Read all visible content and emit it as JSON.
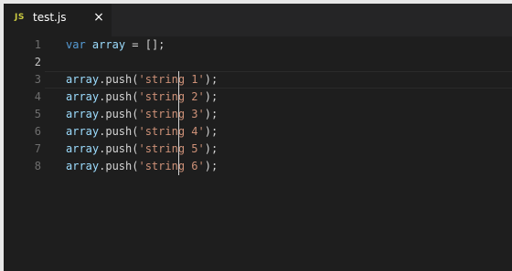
{
  "tab": {
    "lang_badge": "JS",
    "title": "test.js",
    "close_symbol": "×"
  },
  "line_numbers": [
    "1",
    "2",
    "3",
    "4",
    "5",
    "6",
    "7",
    "8"
  ],
  "code": {
    "line1": {
      "kw": "var",
      "name": "array",
      "rest": " = [];"
    },
    "lines": [
      {
        "obj": "array",
        "call": ".push(",
        "str": "'string 1'",
        "end": ");"
      },
      {
        "obj": "array",
        "call": ".push(",
        "str": "'string 2'",
        "end": ");"
      },
      {
        "obj": "array",
        "call": ".push(",
        "str": "'string 3'",
        "end": ");"
      },
      {
        "obj": "array",
        "call": ".push(",
        "str": "'string 4'",
        "end": ");"
      },
      {
        "obj": "array",
        "call": ".push(",
        "str": "'string 5'",
        "end": ");"
      },
      {
        "obj": "array",
        "call": ".push(",
        "str": "'string 6'",
        "end": ");"
      }
    ]
  },
  "colors": {
    "keyword": "#569cd6",
    "variable": "#9cdcfe",
    "string": "#ce9178",
    "punctuation": "#d4d4d4",
    "background": "#1e1e1e"
  }
}
